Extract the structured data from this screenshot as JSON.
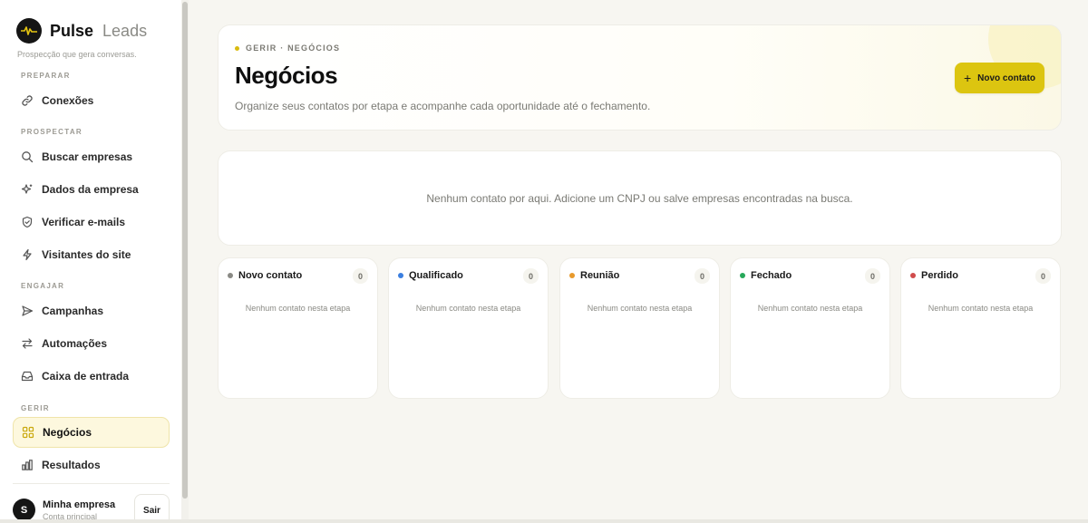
{
  "brand": {
    "name": "Pulse",
    "suffix": "Leads",
    "tagline": "Prospecção que gera conversas."
  },
  "sidebar": {
    "sections": [
      {
        "label": "PREPARAR"
      },
      {
        "label": "PROSPECTAR"
      },
      {
        "label": "ENGAJAR"
      },
      {
        "label": "GERIR"
      }
    ],
    "items": [
      {
        "label": "Conexões",
        "icon": "link-icon"
      },
      {
        "label": "Buscar empresas",
        "icon": "search-icon"
      },
      {
        "label": "Dados da empresa",
        "icon": "sparkle-icon"
      },
      {
        "label": "Verificar e-mails",
        "icon": "shield-check-icon"
      },
      {
        "label": "Visitantes do site",
        "icon": "bolt-icon"
      },
      {
        "label": "Campanhas",
        "icon": "send-icon"
      },
      {
        "label": "Automações",
        "icon": "swap-arrows-icon"
      },
      {
        "label": "Caixa de entrada",
        "icon": "inbox-icon"
      },
      {
        "label": "Negócios",
        "icon": "grid-icon",
        "active": true
      },
      {
        "label": "Resultados",
        "icon": "bar-chart-icon"
      }
    ],
    "account": {
      "initial": "S",
      "name": "Minha empresa",
      "role": "Conta principal",
      "logout_label": "Sair"
    }
  },
  "header": {
    "eyebrow": "GERIR · NEGÓCIOS",
    "title": "Negócios",
    "description": "Organize seus contatos por etapa e acompanhe cada oportunidade até o fechamento.",
    "primary_button": "Novo contato"
  },
  "empty_state": "Nenhum contato por aqui. Adicione um CNPJ ou salve empresas encontradas na busca.",
  "pipeline": {
    "stages": [
      {
        "title": "Novo contato",
        "count": "0",
        "color": "#8a8a85",
        "empty": "Nenhum contato nesta etapa"
      },
      {
        "title": "Qualificado",
        "count": "0",
        "color": "#3b7fe0",
        "empty": "Nenhum contato nesta etapa"
      },
      {
        "title": "Reunião",
        "count": "0",
        "color": "#e89a2c",
        "empty": "Nenhum contato nesta etapa"
      },
      {
        "title": "Fechado",
        "count": "0",
        "color": "#27a85a",
        "empty": "Nenhum contato nesta etapa"
      },
      {
        "title": "Perdido",
        "count": "0",
        "color": "#d04c4c",
        "empty": "Nenhum contato nesta etapa"
      }
    ]
  },
  "colors": {
    "accent": "#dcc510",
    "active_bg": "#fdf8de"
  }
}
